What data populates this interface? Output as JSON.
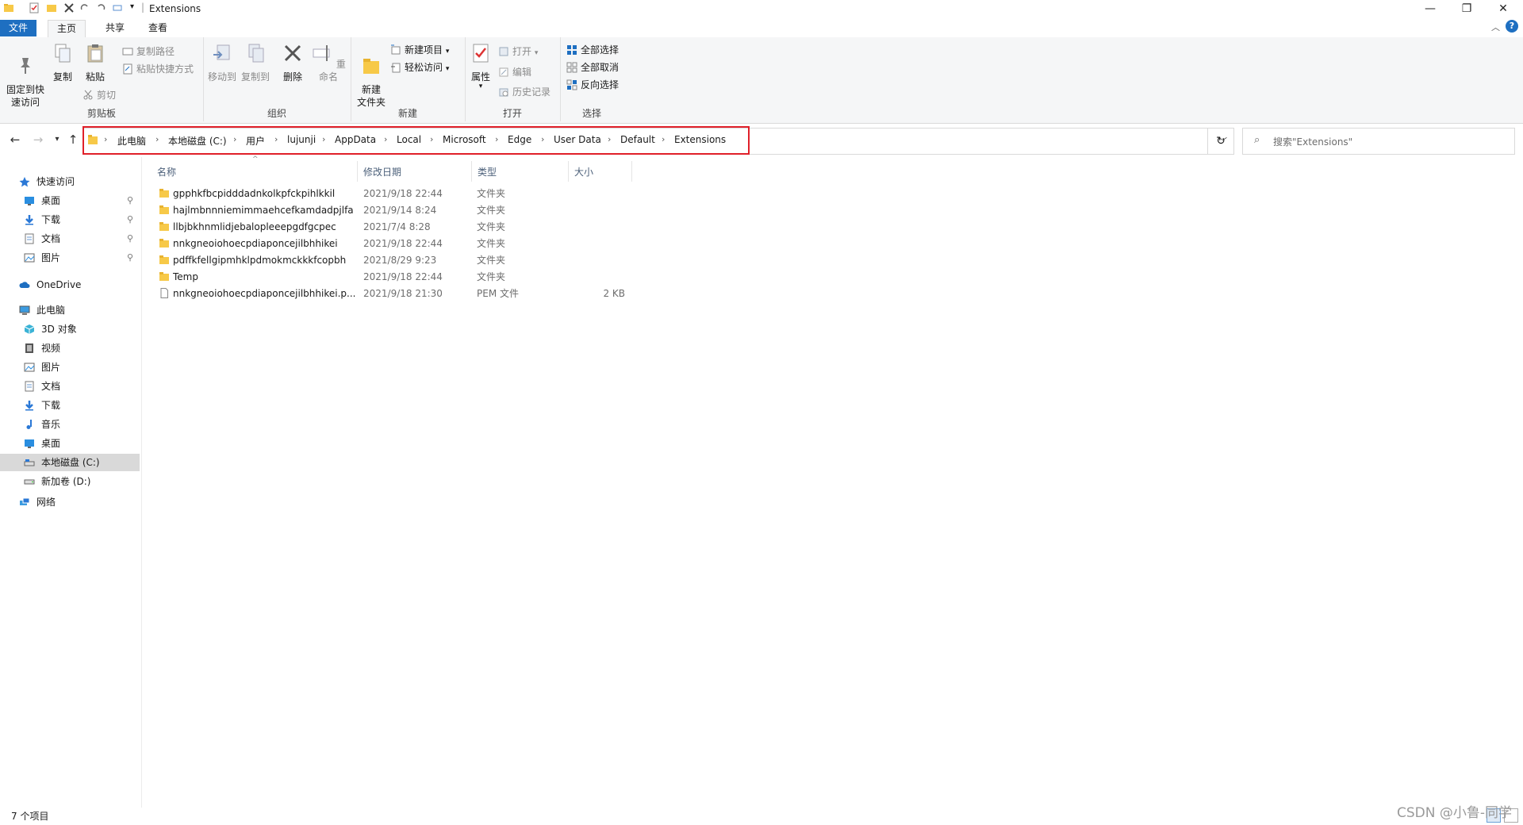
{
  "window": {
    "title": "Extensions",
    "minimize": "—",
    "restore": "❐",
    "close": "✕"
  },
  "tabs": {
    "file": "文件",
    "home": "主页",
    "share": "共享",
    "view": "查看"
  },
  "ribbon": {
    "clipboard": {
      "label": "剪贴板",
      "pin": "固定到快\n速访问",
      "copy": "复制",
      "paste": "粘贴",
      "copy_path": "复制路径",
      "paste_shortcut": "粘贴快捷方式",
      "cut": "剪切"
    },
    "organize": {
      "label": "组织",
      "move_to": "移动到",
      "copy_to": "复制到",
      "delete": "删除",
      "rename": "重命名"
    },
    "new": {
      "label": "新建",
      "new_folder": "新建\n文件夹",
      "new_item": "新建项目",
      "easy_access": "轻松访问"
    },
    "open": {
      "label": "打开",
      "properties": "属性",
      "open": "打开",
      "edit": "编辑",
      "history": "历史记录"
    },
    "select": {
      "label": "选择",
      "select_all": "全部选择",
      "select_none": "全部取消",
      "invert": "反向选择"
    }
  },
  "breadcrumb": [
    "此电脑",
    "本地磁盘 (C:)",
    "用户",
    "lujunji",
    "AppData",
    "Local",
    "Microsoft",
    "Edge",
    "User Data",
    "Default",
    "Extensions"
  ],
  "search": {
    "placeholder": "搜索\"Extensions\""
  },
  "nav": {
    "quick_access": "快速访问",
    "qa_items": [
      "桌面",
      "下载",
      "文档",
      "图片"
    ],
    "onedrive": "OneDrive",
    "this_pc": "此电脑",
    "pc_items": [
      "3D 对象",
      "视频",
      "图片",
      "文档",
      "下载",
      "音乐",
      "桌面",
      "本地磁盘 (C:)",
      "新加卷 (D:)"
    ],
    "network": "网络"
  },
  "columns": {
    "name": "名称",
    "date": "修改日期",
    "type": "类型",
    "size": "大小"
  },
  "files": [
    {
      "name": "gpphkfbcpidddadnkolkpfckpihlkkil",
      "date": "2021/9/18 22:44",
      "type": "文件夹",
      "size": ""
    },
    {
      "name": "hajlmbnnniemimmaehcefkamdadpjlfa",
      "date": "2021/9/14 8:24",
      "type": "文件夹",
      "size": ""
    },
    {
      "name": "llbjbkhnmlidjebalopleeepgdfgcpec",
      "date": "2021/7/4 8:28",
      "type": "文件夹",
      "size": ""
    },
    {
      "name": "nnkgneoiohoecpdiaponcejilbhhikei",
      "date": "2021/9/18 22:44",
      "type": "文件夹",
      "size": ""
    },
    {
      "name": "pdffkfellgipmhklpdmokmckkkfcopbh",
      "date": "2021/8/29 9:23",
      "type": "文件夹",
      "size": ""
    },
    {
      "name": "Temp",
      "date": "2021/9/18 22:44",
      "type": "文件夹",
      "size": ""
    },
    {
      "name": "nnkgneoiohoecpdiaponcejilbhhikei.p...",
      "date": "2021/9/18 21:30",
      "type": "PEM 文件",
      "size": "2 KB"
    }
  ],
  "status": {
    "count": "7 个项目"
  },
  "watermark": "CSDN @小鲁-同学",
  "colors": {
    "accent": "#1e6fc1",
    "folder": "#f7c948",
    "highlight": "#e0202a"
  }
}
